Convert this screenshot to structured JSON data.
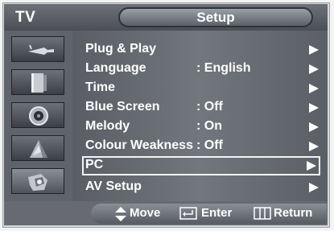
{
  "header": {
    "source": "TV",
    "title": "Setup"
  },
  "sidebar": {
    "items": [
      {
        "icon": "input-antenna-icon"
      },
      {
        "icon": "picture-icon"
      },
      {
        "icon": "sound-icon"
      },
      {
        "icon": "channel-icon"
      },
      {
        "icon": "setup-icon"
      }
    ]
  },
  "menu": {
    "items": [
      {
        "label": "Plug & Play",
        "value": ""
      },
      {
        "label": "Language",
        "value": ": English"
      },
      {
        "label": "Time",
        "value": ""
      },
      {
        "label": "Blue Screen",
        "value": ": Off"
      },
      {
        "label": "Melody",
        "value": ": On"
      },
      {
        "label": "Colour Weakness",
        "value": ": Off"
      },
      {
        "label": "PC",
        "value": "",
        "selected": true
      },
      {
        "label": "AV Setup",
        "value": ""
      }
    ]
  },
  "footer": {
    "move": "Move",
    "enter": "Enter",
    "return": "Return"
  }
}
